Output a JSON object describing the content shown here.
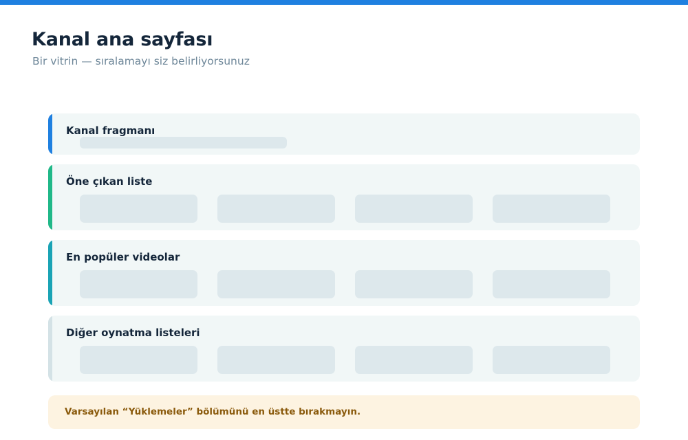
{
  "header": {
    "title": "Kanal ana sayfası",
    "subtitle": "Bir vitrin — sıralamayı siz belirliyorsunuz"
  },
  "colors": {
    "topbar": "#1f80e0",
    "trailer_accent": "#1f80e0",
    "featured_accent": "#20b888",
    "popular_accent": "#1aa3b5",
    "other_accent": "#d4e2e6"
  },
  "sections": [
    {
      "label": "Kanal fragmanı"
    },
    {
      "label": "Öne çıkan liste",
      "items": 4
    },
    {
      "label": "En popüler videolar",
      "items": 4
    },
    {
      "label": "Diğer oynatma listeleri",
      "items": 4
    }
  ],
  "warning": {
    "text": "Varsayılan “Yüklemeler” bölümünü en üstte bırakmayın."
  }
}
